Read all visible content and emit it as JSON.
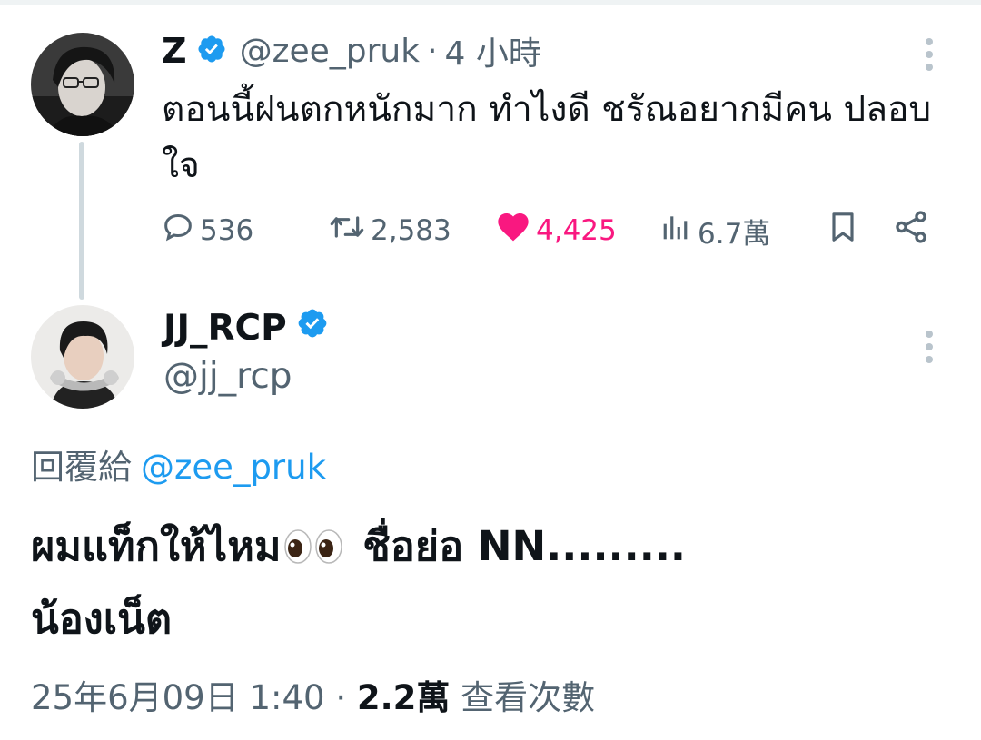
{
  "tweet1": {
    "name": "Z",
    "handle": "@zee_pruk",
    "separator": "·",
    "time": "4 小時",
    "text": "ตอนนี้ฝนตกหนักมาก ทำไงดี ชรัณอยากมีคน ปลอบใจ",
    "stats": {
      "replies": "536",
      "retweets": "2,583",
      "likes": "4,425",
      "views": "6.7萬"
    }
  },
  "tweet2": {
    "name": "JJ_RCP",
    "handle": "@jj_rcp",
    "replying_label": "回覆給",
    "replying_to": "@zee_pruk",
    "text_line1_before": "ผมแท็กให้ไหม",
    "text_line1_after": " ชื่อย่อ NN.........",
    "text_line2": "น้องเน็ต",
    "date": "25年6月09日 1:40",
    "separator": "·",
    "views_count": "2.2萬",
    "views_label": "查看次數"
  },
  "colors": {
    "text_primary": "#0f1419",
    "text_secondary": "#536471",
    "link": "#1d9bf0",
    "like_active": "#f91880",
    "verified": "#1d9bf0"
  },
  "icons": [
    "verified-badge-icon",
    "reply-icon",
    "retweet-icon",
    "heart-icon",
    "views-icon",
    "bookmark-icon",
    "share-icon",
    "more-icon",
    "eyes-emoji-icon"
  ]
}
